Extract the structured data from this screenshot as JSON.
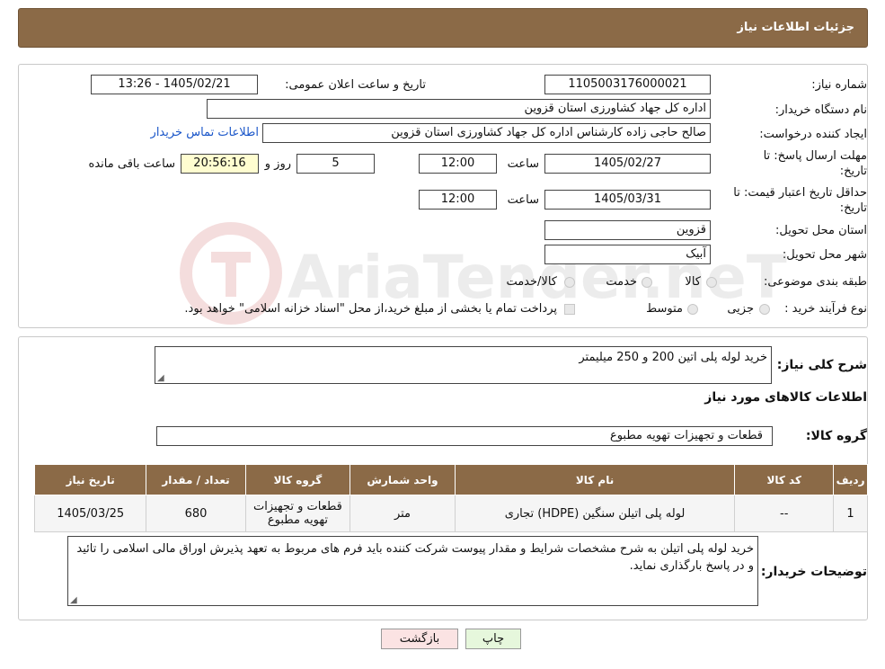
{
  "header": {
    "title": "جزئیات اطلاعات نیاز"
  },
  "form": {
    "need_number_label": "شماره نیاز:",
    "need_number": "1105003176000021",
    "announce_label": "تاریخ و ساعت اعلان عمومی:",
    "announce_value": "1405/02/21 - 13:26",
    "buyer_org_label": "نام دستگاه خریدار:",
    "buyer_org": "اداره کل جهاد کشاورزی استان قزوین",
    "creator_label": "ایجاد کننده درخواست:",
    "creator": "صالح حاجی زاده کارشناس اداره کل جهاد کشاورزی استان قزوین",
    "contact_link": "اطلاعات تماس خریدار",
    "deadline_label_1": "مهلت ارسال پاسخ: تا",
    "deadline_label_2": "تاریخ:",
    "deadline_date": "1405/02/27",
    "time_label": "ساعت",
    "deadline_time": "12:00",
    "days_value": "5",
    "days_label": "روز و",
    "remaining_time": "20:56:16",
    "remaining_label": "ساعت باقی مانده",
    "validity_label_1": "حداقل تاریخ اعتبار قیمت: تا",
    "validity_label_2": "تاریخ:",
    "validity_date": "1405/03/31",
    "validity_time": "12:00",
    "province_label": "استان محل تحویل:",
    "province": "قزوین",
    "city_label": "شهر محل تحویل:",
    "city": "آبیک",
    "category_label": "طبقه بندی موضوعی:",
    "category_options": [
      "کالا",
      "خدمت",
      "کالا/خدمت"
    ],
    "process_label": "نوع فرآیند خرید :",
    "process_options": [
      "جزیی",
      "متوسط"
    ],
    "payment_note": "پرداخت تمام یا بخشی از مبلغ خرید،از محل \"اسناد خزانه اسلامی\" خواهد بود."
  },
  "summary": {
    "description_label": "شرح کلی نیاز:",
    "description": "خرید لوله پلی اتین 200 و 250 میلیمتر",
    "goods_info_title": "اطلاعات کالاهای مورد نیاز",
    "goods_group_label": "گروه کالا:",
    "goods_group": "قطعات و تجهیزات تهویه مطبوع"
  },
  "table": {
    "headers": [
      "ردیف",
      "کد کالا",
      "نام کالا",
      "واحد شمارش",
      "گروه کالا",
      "تعداد / مقدار",
      "تاریخ نیاز"
    ],
    "rows": [
      [
        "1",
        "--",
        "لوله پلی اتیلن سنگین (HDPE) تجاری",
        "متر",
        "قطعات و تجهیزات تهویه مطبوع",
        "680",
        "1405/03/25"
      ]
    ]
  },
  "buyer_notes": {
    "label": "توضیحات خریدار:",
    "text": "خرید لوله پلی اتیلن به شرح مشخصات شرایط و مقدار پیوست شرکت کننده باید فرم های مربوط به تعهد پذیرش اوراق مالی اسلامی را تائید و در پاسخ بارگذاری نماید."
  },
  "buttons": {
    "print": "چاپ",
    "back": "بازگشت"
  },
  "watermark": {
    "text": "AriaTender.neT"
  },
  "colors": {
    "header_bg": "#8b6a47",
    "print_bg": "#e6f7dc",
    "back_bg": "#fbe3e3",
    "link": "#1a56c9"
  }
}
